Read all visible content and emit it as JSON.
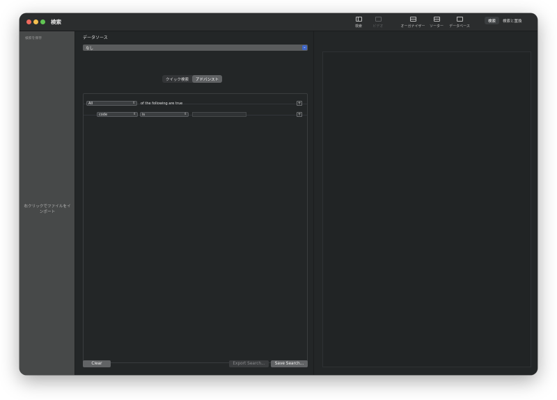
{
  "window": {
    "title": "検索"
  },
  "toolbar": {
    "items": [
      {
        "label": "検索",
        "icon": "sidebar-icon",
        "enabled": true
      },
      {
        "label": "ビデオ",
        "icon": "video-icon",
        "enabled": false
      },
      {
        "label": "オーガナイザー",
        "icon": "organizer-icon",
        "enabled": true
      },
      {
        "label": "ソーター",
        "icon": "sorter-icon",
        "enabled": true
      },
      {
        "label": "データベース",
        "icon": "database-icon",
        "enabled": true
      }
    ],
    "segment": {
      "active": "検索",
      "inactive": "検索と置換"
    }
  },
  "sidebar": {
    "header": "検索を保存",
    "hint": "右クリックでファイルをインポート"
  },
  "datasource": {
    "label": "データソース",
    "value": "なし"
  },
  "tabs": {
    "quick": "クイック検索",
    "advanced": "アドバンスト",
    "active": "アドバンスト"
  },
  "criteria": {
    "match_value": "All",
    "match_suffix": "of the following are true",
    "rule": {
      "field": "code",
      "operator": "is",
      "value": ""
    },
    "add_symbol": "+"
  },
  "buttons": {
    "clear": "Clear",
    "export": "Export Search...",
    "save": "Save Search..."
  },
  "colors": {
    "window_bg": "#232627",
    "sidebar_bg": "#474949",
    "accent": "#3e65c7"
  }
}
